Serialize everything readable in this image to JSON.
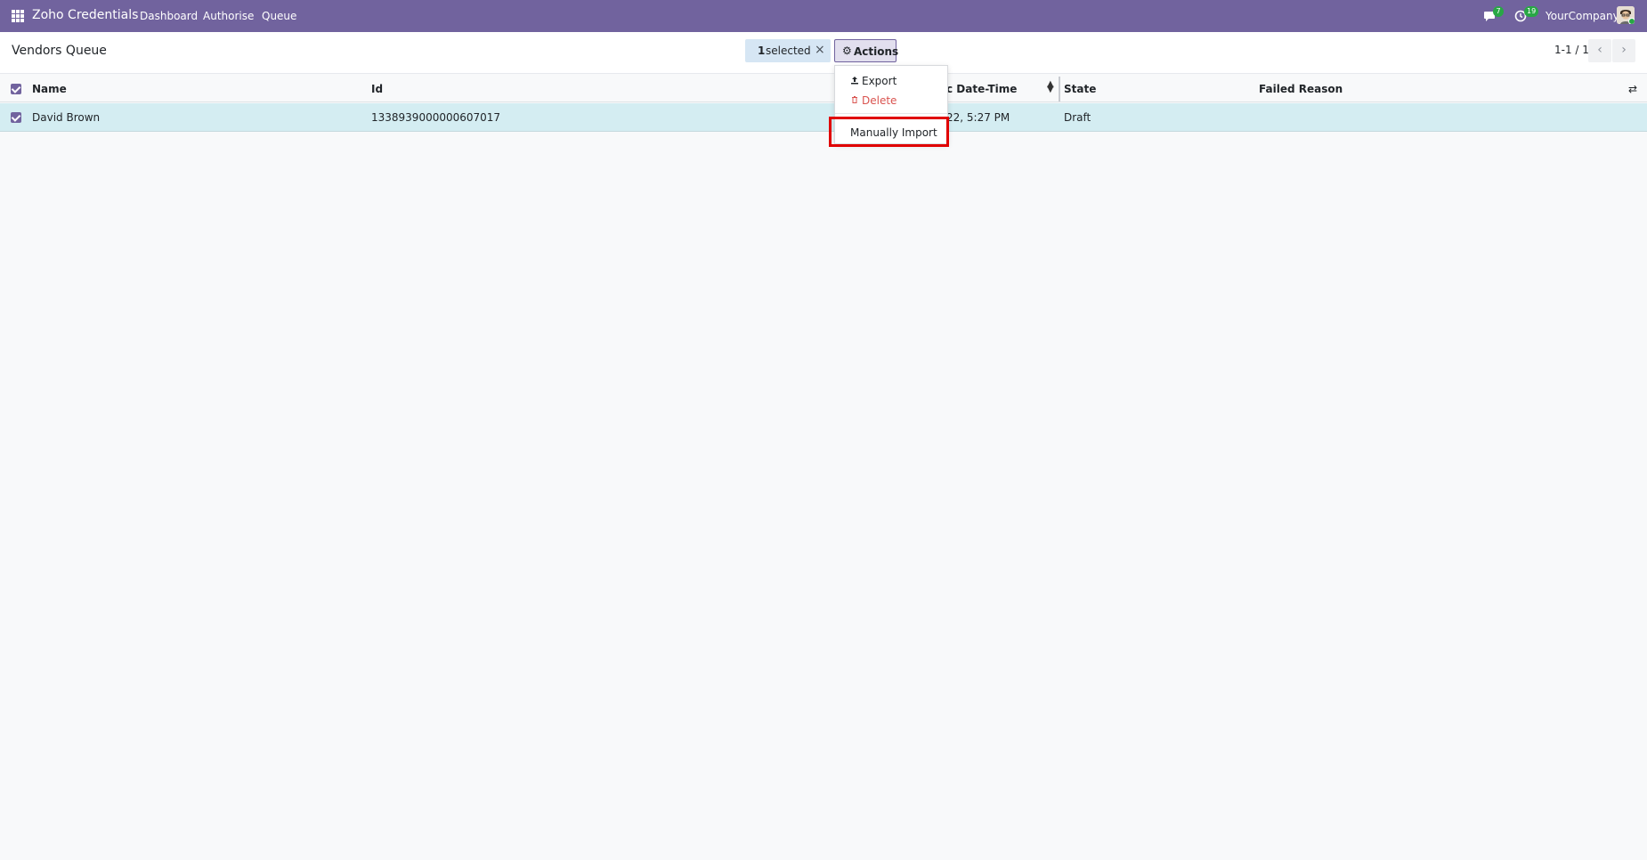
{
  "app": {
    "title": "Zoho Credentials",
    "menu": [
      "Dashboard",
      "Authorise",
      "Queue"
    ],
    "messages_count": "7",
    "activities_count": "19",
    "company": "YourCompany"
  },
  "control": {
    "page_title": "Vendors Queue",
    "selected_count": "1",
    "selected_label": "selected",
    "clear_icon": "×",
    "actions_label": "Actions",
    "pager": "1-1 / 1"
  },
  "table": {
    "columns": [
      "Name",
      "Id",
      "c Date-Time",
      "State",
      "Failed Reason"
    ],
    "rows": [
      {
        "name": "David Brown",
        "id": "1338939000000607017",
        "datetime": "22, 5:27 PM",
        "state": "Draft",
        "failed_reason": ""
      }
    ]
  },
  "dropdown": {
    "items": [
      {
        "label": "Export",
        "icon": "upload-icon"
      },
      {
        "label": "Delete",
        "icon": "trash-icon"
      },
      {
        "label": "Manually Import",
        "icon": ""
      }
    ]
  },
  "colors": {
    "navbar": "#71639e",
    "selected_row": "#d4edf2",
    "danger": "#d9534f",
    "highlight": "#e00000",
    "badge": "#28a745"
  }
}
